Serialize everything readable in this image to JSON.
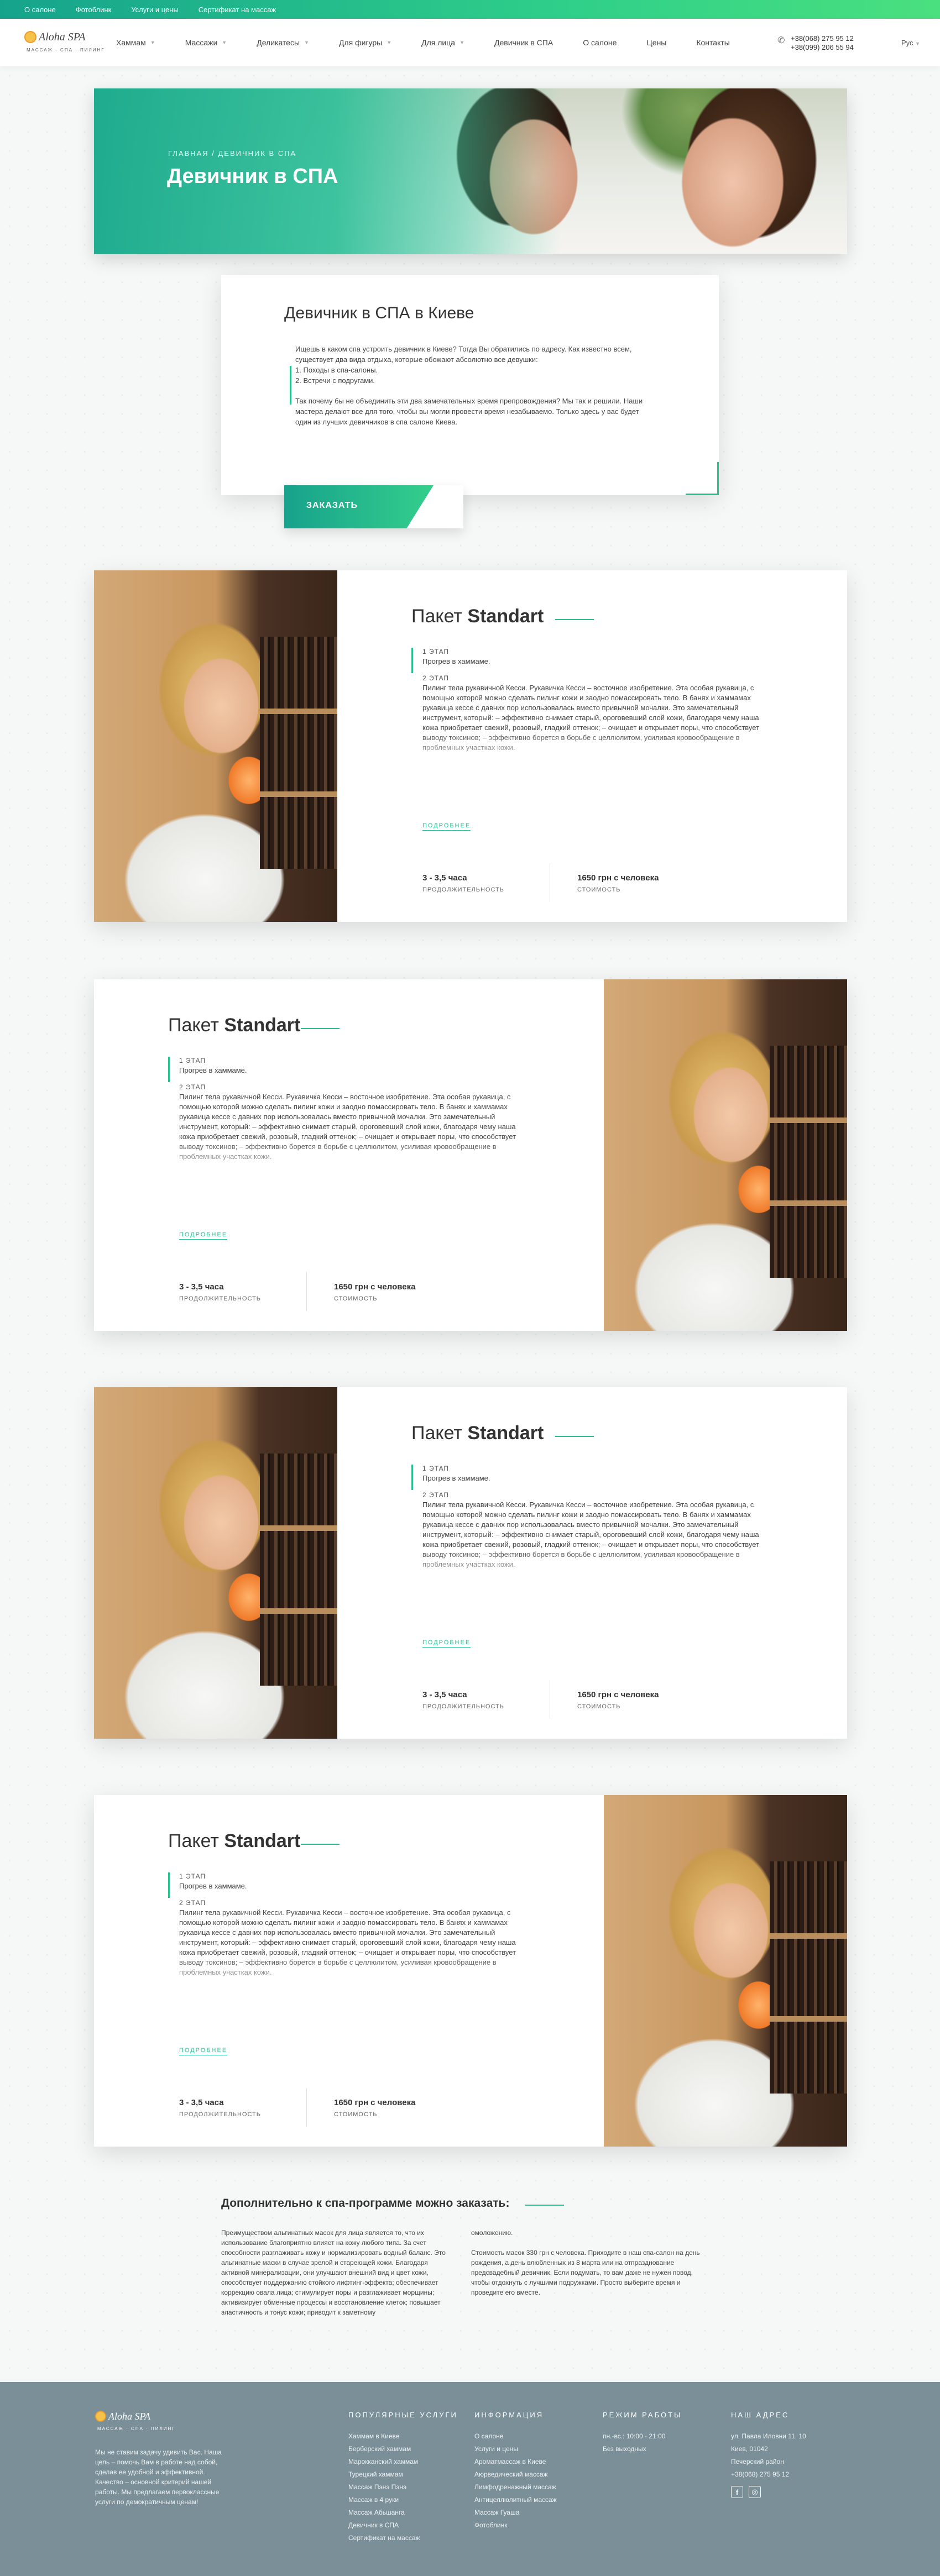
{
  "topbar": {
    "links": [
      "О салоне",
      "Фотоблинк",
      "Услуги и цены",
      "Сертификат на массаж"
    ]
  },
  "header": {
    "logo_name": "Aloha SPA",
    "logo_tag": "МАССАЖ · СПА · ПИЛИНГ",
    "nav": [
      "Хаммам",
      "Массажи",
      "Деликатесы",
      "Для фигуры",
      "Для лица",
      "Девичник в СПА",
      "О салоне",
      "Цены",
      "Контакты"
    ],
    "phone1": "+38(068) 275 95 12",
    "phone2": "+38(099) 206 55 94",
    "lang": "Рус"
  },
  "hero": {
    "breadcrumb": "ГЛАВНАЯ / ДЕВИЧНИК В СПА",
    "title": "Девичник в СПА"
  },
  "intro": {
    "title": "Девичник в СПА в Киеве",
    "p1": "Ищешь в каком спа устроить девичник в Киеве? Тогда Вы обратились по адресу. Как известно всем, существует два вида отдыха, которые обожают абсолютно все девушки:",
    "item1": "1. Походы в спа-салоны.",
    "item2": "2. Встречи с подругами.",
    "p2": "Так почему бы не объединить эти два замечательных время препровождения? Мы так и решили. Наши мастера делают все для того, чтобы вы могли провести время незабываемо. Только здесь у вас будет один из лучших девичников в спа салоне Киева.",
    "order_button": "ЗАКАЗАТЬ"
  },
  "packages": [
    {
      "title_prefix": "Пакет",
      "title_name": "Standart",
      "step1_num": "1 ЭТАП",
      "step1_text": "Прогрев в хаммаме.",
      "step2_num": "2 ЭТАП",
      "step2_text": "Пилинг тела рукавичной Кесси. Рукавичка Кесси – восточное изобретение. Эта особая рукавица, с помощью которой можно сделать пилинг кожи и заодно помассировать тело. В банях и хаммамах рукавица кессе с давних пор использовалась вместо привычной мочалки. Это замечательный инструмент, который: – эффективно снимает старый, ороговевший слой кожи, благодаря чему наша кожа приобретает свежий, розовый, гладкий оттенок; – очищает и открывает поры, что способствует выводу токсинов; – эффективно борется в борьбе с целлюлитом, усиливая кровообращение в проблемных участках кожи.",
      "more": "ПОДРОБНЕЕ",
      "duration_value": "3 - 3,5 часа",
      "duration_label": "ПРОДОЛЖИТЕЛЬНОСТЬ",
      "price_value": "1650 грн с человека",
      "price_label": "СТОИМОСТЬ"
    },
    {
      "title_prefix": "Пакет",
      "title_name": "Standart",
      "step1_num": "1 ЭТАП",
      "step1_text": "Прогрев в хаммаме.",
      "step2_num": "2 ЭТАП",
      "step2_text": "Пилинг тела рукавичной Кесси. Рукавичка Кесси – восточное изобретение. Эта особая рукавица, с помощью которой можно сделать пилинг кожи и заодно помассировать тело. В банях и хаммамах рукавица кессе с давних пор использовалась вместо привычной мочалки. Это замечательный инструмент, который: – эффективно снимает старый, ороговевший слой кожи, благодаря чему наша кожа приобретает свежий, розовый, гладкий оттенок; – очищает и открывает поры, что способствует выводу токсинов; – эффективно борется в борьбе с целлюлитом, усиливая кровообращение в проблемных участках кожи.",
      "more": "ПОДРОБНЕЕ",
      "duration_value": "3 - 3,5 часа",
      "duration_label": "ПРОДОЛЖИТЕЛЬНОСТЬ",
      "price_value": "1650 грн с человека",
      "price_label": "СТОИМОСТЬ"
    },
    {
      "title_prefix": "Пакет",
      "title_name": "Standart",
      "step1_num": "1 ЭТАП",
      "step1_text": "Прогрев в хаммаме.",
      "step2_num": "2 ЭТАП",
      "step2_text": "Пилинг тела рукавичной Кесси. Рукавичка Кесси – восточное изобретение. Эта особая рукавица, с помощью которой можно сделать пилинг кожи и заодно помассировать тело. В банях и хаммамах рукавица кессе с давних пор использовалась вместо привычной мочалки. Это замечательный инструмент, который: – эффективно снимает старый, ороговевший слой кожи, благодаря чему наша кожа приобретает свежий, розовый, гладкий оттенок; – очищает и открывает поры, что способствует выводу токсинов; – эффективно борется в борьбе с целлюлитом, усиливая кровообращение в проблемных участках кожи.",
      "more": "ПОДРОБНЕЕ",
      "duration_value": "3 - 3,5 часа",
      "duration_label": "ПРОДОЛЖИТЕЛЬНОСТЬ",
      "price_value": "1650 грн с человека",
      "price_label": "СТОИМОСТЬ"
    },
    {
      "title_prefix": "Пакет",
      "title_name": "Standart",
      "step1_num": "1 ЭТАП",
      "step1_text": "Прогрев в хаммаме.",
      "step2_num": "2 ЭТАП",
      "step2_text": "Пилинг тела рукавичной Кесси. Рукавичка Кесси – восточное изобретение. Эта особая рукавица, с помощью которой можно сделать пилинг кожи и заодно помассировать тело. В банях и хаммамах рукавица кессе с давних пор использовалась вместо привычной мочалки. Это замечательный инструмент, который: – эффективно снимает старый, ороговевший слой кожи, благодаря чему наша кожа приобретает свежий, розовый, гладкий оттенок; – очищает и открывает поры, что способствует выводу токсинов; – эффективно борется в борьбе с целлюлитом, усиливая кровообращение в проблемных участках кожи.",
      "more": "ПОДРОБНЕЕ",
      "duration_value": "3 - 3,5 часа",
      "duration_label": "ПРОДОЛЖИТЕЛЬНОСТЬ",
      "price_value": "1650 грн с человека",
      "price_label": "СТОИМОСТЬ"
    }
  ],
  "extra": {
    "title": "Дополнительно к спа-программе можно заказать:",
    "col1": "Преимуществом альгинатных масок для лица является то, что их использование благоприятно влияет на кожу любого типа. За счет способности разглаживать кожу и нормализировать водный баланс. Это альгинатные маски в случае зрелой и стареющей кожи. Благодаря активной минерализации, они улучшают внешний вид и цвет кожи, способствует поддержанию стойкого лифтинг-эффекта; обеспечивает коррекцию овала лица; стимулирует поры и разглаживает морщины; активизирует обменные процессы и восстановление клеток; повышает эластичность и тонус кожи; приводит к заметному",
    "col2a": "омоложению.",
    "col2b": "Стоимость масок 330 грн с человека. Приходите в наш спа-салон на день рождения, а день влюбленных из 8 марта или на отпразднование предсвадебный девичник. Если подумать, то вам даже не нужен повод, чтобы отдохнуть с лучшими подружками. Просто выберите время и проведите его вместе."
  },
  "footer": {
    "logo_name": "Aloha SPA",
    "logo_tag": "МАССАЖ · СПА · ПИЛИНГ",
    "desc": "Мы не ставим задачу удивить Вас. Наша цель – помочь Вам в работе над собой, сделав ее удобной и эффективной. Качество – основной критерий нашей работы. Мы предлагаем первоклассные услуги по демократичным ценам!",
    "popular_title": "ПОПУЛЯРНЫЕ УСЛУГИ",
    "popular": [
      "Хаммам в Киеве",
      "Берберский хаммам",
      "Марокканский хаммам",
      "Турецкий хаммам",
      "Массаж Пэнэ Пэнэ",
      "Массаж в 4 руки",
      "Массаж Абьшанга",
      "Девичник в СПА",
      "Сертификат на массаж"
    ],
    "info_title": "ИНФОРМАЦИЯ",
    "info": [
      "О салоне",
      "Услуги и цены",
      "Ароматмассаж в Киеве",
      "Аюрведический массаж",
      "Лимфодренажный массаж",
      "Антицеллюлитный массаж",
      "Массаж Гуаша",
      "Фотоблинк"
    ],
    "hours_title": "РЕЖИМ РАБОТЫ",
    "hours": [
      "пн.-вс.: 10:00 - 21:00",
      "Без выходных"
    ],
    "address_title": "НАШ АДРЕС",
    "address": [
      "ул. Павла Иловни 11, 10",
      "Киев, 01042",
      "Печерский район",
      "+38(068) 275 95 12"
    ],
    "social": [
      "f",
      "◎"
    ]
  }
}
